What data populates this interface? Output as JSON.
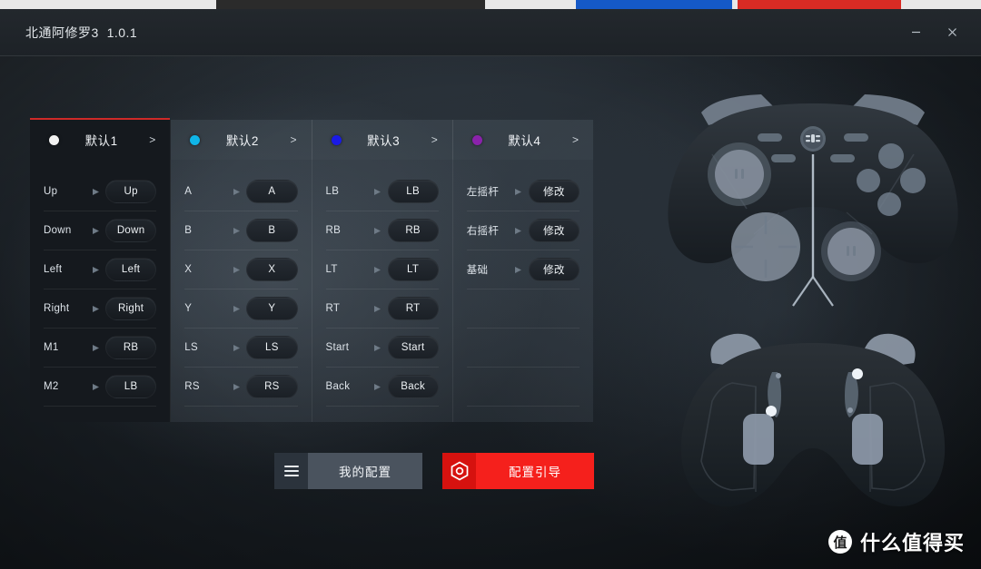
{
  "window": {
    "title": "北通阿修罗3  1.0.1",
    "minimize_icon": "minimize-icon",
    "close_icon": "close-icon"
  },
  "colors": {
    "accent_red": "#cf2a28",
    "button_red": "#f5201c",
    "button_gray": "#4a535e",
    "panel_active_bg": "#15191e"
  },
  "tabs": [
    {
      "label": "默认1",
      "dot_color": "#f2f2f2",
      "arrow": ">",
      "active": true
    },
    {
      "label": "默认2",
      "dot_color": "#0fb5e8",
      "arrow": ">",
      "active": false
    },
    {
      "label": "默认3",
      "dot_color": "#1a1ae6",
      "arrow": ">",
      "active": false
    },
    {
      "label": "默认4",
      "dot_color": "#8a22ab",
      "arrow": ">",
      "active": false
    }
  ],
  "panels": [
    {
      "name": "dpad-and-macro-panel",
      "active": true,
      "rows": [
        {
          "source": "Up",
          "target": "Up"
        },
        {
          "source": "Down",
          "target": "Down"
        },
        {
          "source": "Left",
          "target": "Left"
        },
        {
          "source": "Right",
          "target": "Right"
        },
        {
          "source": "M1",
          "target": "RB"
        },
        {
          "source": "M2",
          "target": "LB"
        }
      ]
    },
    {
      "name": "face-buttons-panel",
      "active": false,
      "rows": [
        {
          "source": "A",
          "target": "A"
        },
        {
          "source": "B",
          "target": "B"
        },
        {
          "source": "X",
          "target": "X"
        },
        {
          "source": "Y",
          "target": "Y"
        },
        {
          "source": "LS",
          "target": "LS"
        },
        {
          "source": "RS",
          "target": "RS"
        }
      ]
    },
    {
      "name": "shoulder-and-system-panel",
      "active": false,
      "rows": [
        {
          "source": "LB",
          "target": "LB"
        },
        {
          "source": "RB",
          "target": "RB"
        },
        {
          "source": "LT",
          "target": "LT"
        },
        {
          "source": "RT",
          "target": "RT"
        },
        {
          "source": "Start",
          "target": "Start"
        },
        {
          "source": "Back",
          "target": "Back"
        }
      ]
    },
    {
      "name": "sticks-and-basic-panel",
      "active": false,
      "rows": [
        {
          "source": "左摇杆",
          "target": "修改"
        },
        {
          "source": "右摇杆",
          "target": "修改"
        },
        {
          "source": "基础",
          "target": "修改"
        },
        {
          "source": "",
          "target": ""
        },
        {
          "source": "",
          "target": ""
        },
        {
          "source": "",
          "target": ""
        }
      ]
    }
  ],
  "actions": {
    "my_config": {
      "label": "我的配置",
      "icon": "hamburger-menu-icon"
    },
    "config_guide": {
      "label": "配置引导",
      "icon": "hexagon-target-icon"
    }
  },
  "watermark": {
    "badge": "值",
    "text": "什么值得买"
  }
}
